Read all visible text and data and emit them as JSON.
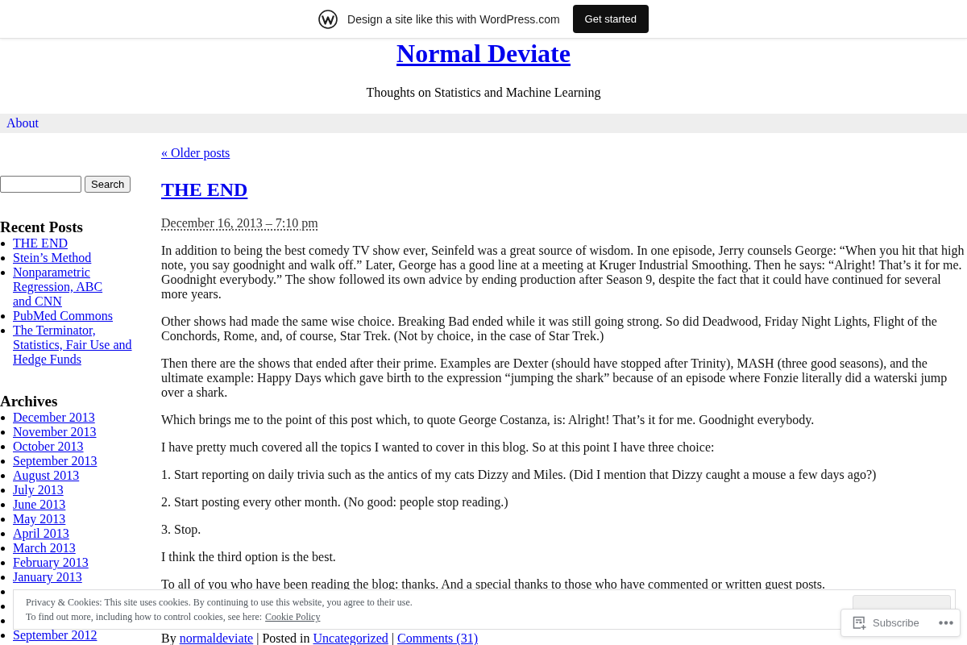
{
  "promo_bar": {
    "text": "Design a site like this with WordPress.com",
    "button": "Get started"
  },
  "header": {
    "title": "Normal Deviate",
    "tagline": "Thoughts on Statistics and Machine Learning"
  },
  "nav": [
    {
      "label": "About"
    }
  ],
  "sidebar": {
    "search": {
      "button": "Search"
    },
    "widgets": [
      {
        "title": "Recent Posts",
        "items": [
          {
            "kind": "link",
            "label": "THE END"
          },
          {
            "kind": "link",
            "label": "Stein’s Method"
          },
          {
            "kind": "link",
            "label": "Nonparametric Regression, ABC and CNN"
          },
          {
            "kind": "link",
            "label": "PubMed Commons"
          },
          {
            "kind": "link",
            "label": "The Terminator, Statistics, Fair Use and Hedge Funds"
          }
        ]
      },
      {
        "title": "Archives",
        "items": [
          {
            "kind": "link",
            "label": "December 2013"
          },
          {
            "kind": "link",
            "label": "November 2013"
          },
          {
            "kind": "link",
            "label": "October 2013"
          },
          {
            "kind": "link",
            "label": "September 2013"
          },
          {
            "kind": "link",
            "label": "August 2013"
          },
          {
            "kind": "link",
            "label": "July 2013"
          },
          {
            "kind": "link",
            "label": "June 2013"
          },
          {
            "kind": "link",
            "label": "May 2013"
          },
          {
            "kind": "link",
            "label": "April 2013"
          },
          {
            "kind": "link",
            "label": "March 2013"
          },
          {
            "kind": "link",
            "label": "February 2013"
          },
          {
            "kind": "link",
            "label": "January 2013"
          },
          {
            "kind": "covered"
          },
          {
            "kind": "covered"
          },
          {
            "kind": "covered"
          },
          {
            "kind": "link",
            "label": "September 2012"
          }
        ]
      }
    ]
  },
  "older_posts": "« Older posts",
  "post": {
    "title": "THE END",
    "date": "December 16, 2013 – 7:10 pm",
    "paragraphs": [
      "In addition to being the best comedy TV show ever, Seinfeld was a great source of wisdom. In one episode, Jerry counsels George: “When you hit that high note, you say goodnight and walk off.” Later, George has a good line at a meeting at Kruger Industrial Smoothing. Then he says: “Alright! That’s it for me. Goodnight everybody.” The show followed its own advice by ending production after Season 9, despite the fact that it could have continued for several more years.",
      "Other shows had made the same wise choice. Breaking Bad ended while it was still going strong. So did Deadwood, Friday Night Lights, Flight of the Conchords, Rome, and, of course, Star Trek. (Not by choice, in the case of Star Trek.)",
      "Then there are the shows that ended after their prime. Examples are Dexter (should have stopped after Trinity), MASH (three good seasons), and the ultimate example: Happy Days which gave birth to the expression “jumping the shark” because of an episode where Fonzie literally did a waterski jump over a shark.",
      "Which brings me to the point of this post which, to quote George Costanza, is: Alright! That’s it for me. Goodnight everybody.",
      "I have pretty much covered all the topics I wanted to cover in this blog. So at this point I have three choice:",
      "1. Start reporting on daily trivia such as the antics of my cats Dizzy and Miles. (Did I mention that Dizzy caught a mouse a few days ago?)",
      "2. Start posting every other month. (No good: people stop reading.)",
      "3. Stop.",
      "I think the third option is the best.",
      "To all of you who have been reading the blog: thanks. And a special thanks to those who have commented or written guest posts."
    ],
    "byline": [
      {
        "kind": "text",
        "text": "By"
      },
      {
        "kind": "link",
        "text": "normaldeviate"
      },
      {
        "kind": "text",
        "text": "| Posted in"
      },
      {
        "kind": "link",
        "text": "Uncategorized"
      },
      {
        "kind": "text",
        "text": "|"
      },
      {
        "kind": "link",
        "text": "Comments (31)"
      }
    ]
  },
  "cookie_banner": {
    "lines": [
      "Privacy & Cookies: This site uses cookies. By continuing to use this website, you agree to their use.",
      "To find out more, including how to control cookies, see here:"
    ],
    "link": "Cookie Policy"
  },
  "subscribe_widget": {
    "label": "Subscribe"
  }
}
